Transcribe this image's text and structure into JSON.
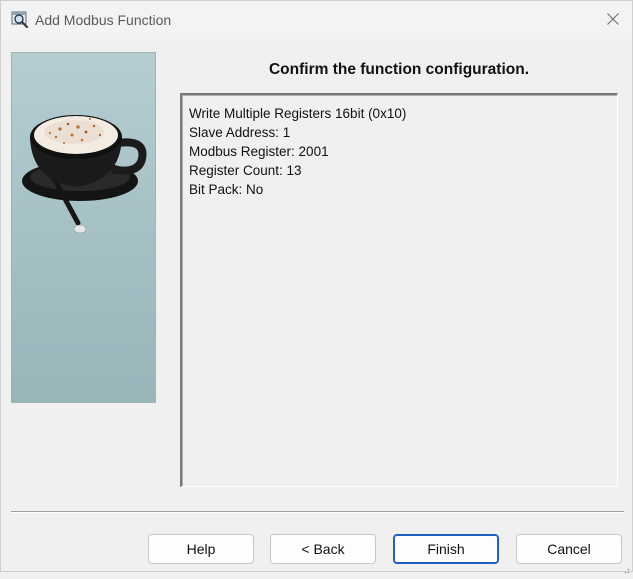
{
  "window": {
    "title": "Add Modbus Function",
    "close_symbol": "×"
  },
  "icons": {
    "app": "magnifier-window-icon",
    "close": "close-icon",
    "side_image": "coffee-cup-illustration"
  },
  "main": {
    "heading": "Confirm the function configuration.",
    "summary_lines": [
      "Write Multiple Registers 16bit (0x10)",
      "Slave Address: 1",
      "Modbus Register: 2001",
      "Register Count: 13",
      "Bit Pack: No"
    ]
  },
  "buttons": {
    "help": "Help",
    "back": "< Back",
    "finish": "Finish",
    "cancel": "Cancel"
  },
  "colors": {
    "default_button_border": "#1f5fbf",
    "side_panel": "#a7c2c7"
  }
}
